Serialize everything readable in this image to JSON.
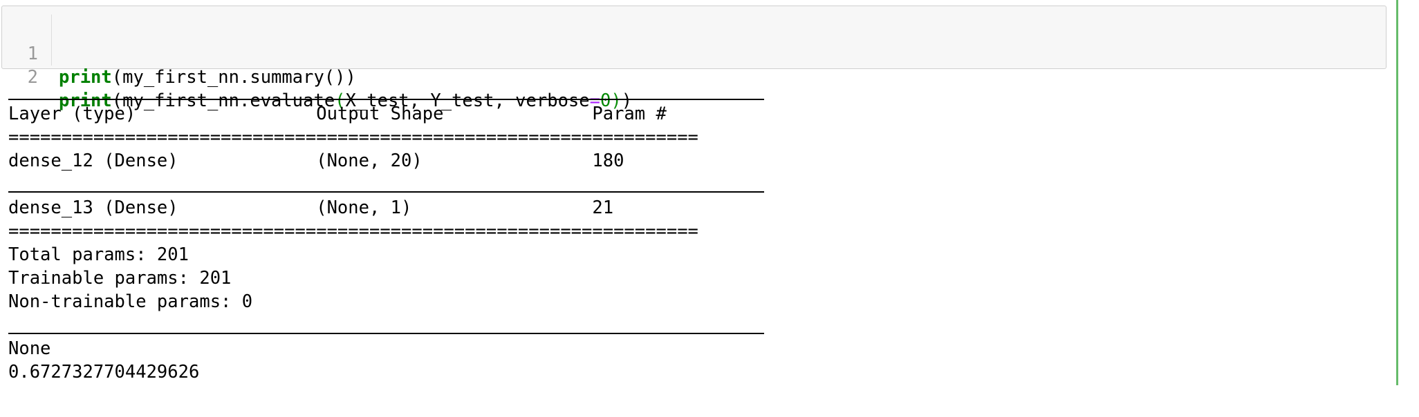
{
  "cell": {
    "input_lines": [
      {
        "number": "1",
        "parts": [
          "print",
          "(",
          "my_first_nn.summary())",
          ""
        ]
      },
      {
        "number": "2"
      }
    ],
    "line1": {
      "number": "1",
      "kw": "print",
      "rest": "(my_first_nn.summary())"
    },
    "line2": {
      "number": "2",
      "kw": "print",
      "open": "(",
      "middle": "my_first_nn.evaluate",
      "open2": "(",
      "args": "X_test, Y_test, verbose",
      "op": "=",
      "num": "0",
      "close2": ")",
      "close": ")"
    }
  },
  "output": {
    "header": "Layer (type)                 Output Shape              Param #   ",
    "equals_line": "=================================================================",
    "rows": [
      "dense_12 (Dense)             (None, 20)                180       ",
      "dense_13 (Dense)             (None, 1)                 21        "
    ],
    "total_params": "Total params: 201",
    "trainable_params": "Trainable params: 201",
    "non_trainable_params": "Non-trainable params: 0",
    "none_text": "None",
    "evaluate_result": "0.6727327704429626"
  }
}
